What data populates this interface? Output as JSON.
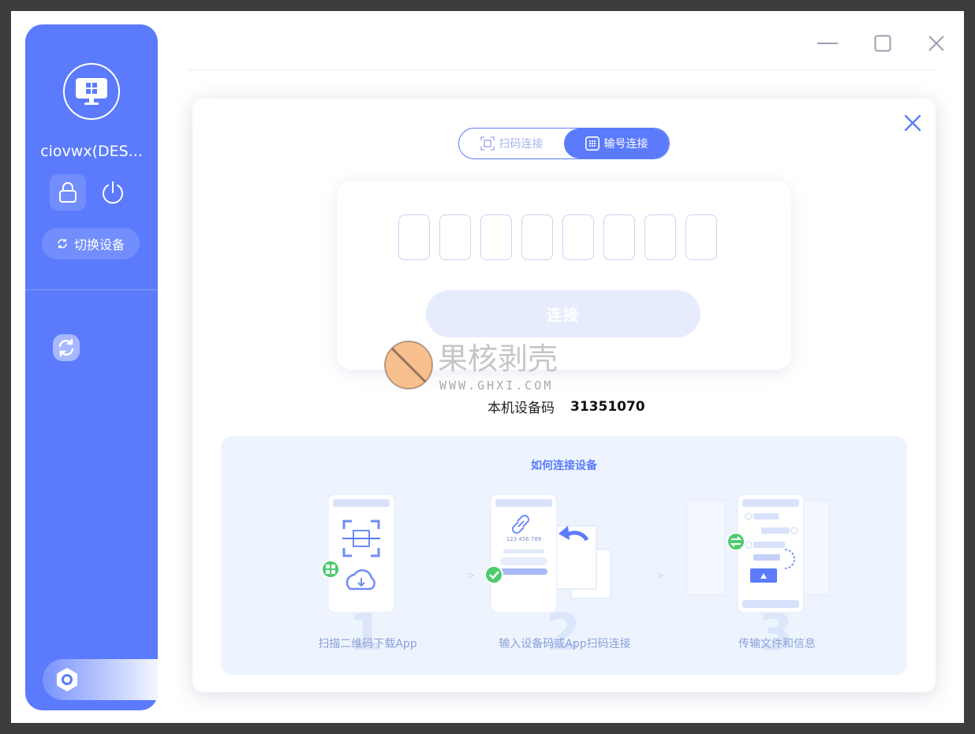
{
  "sidebar": {
    "device_name": "ciovwx(DES...",
    "switch_device_label": "切换设备"
  },
  "dialog": {
    "tabs": [
      {
        "label": "扫码连接",
        "active": false
      },
      {
        "label": "输号连接",
        "active": true
      }
    ],
    "connect_label": "连接",
    "local_code_label": "本机设备码",
    "local_code_value": "31351070",
    "howto": {
      "title": "如何连接设备",
      "steps": [
        {
          "number": "1",
          "label": "扫描二维码下载App"
        },
        {
          "number": "2",
          "label": "输入设备码或App扫码连接"
        },
        {
          "number": "3",
          "label": "传输文件和信息"
        }
      ],
      "sample_code": "123 456 789"
    }
  },
  "watermark": {
    "brand": "果核剥壳",
    "url": "WWW.GHXI.COM"
  },
  "colors": {
    "accent": "#5b7bfc",
    "disabled_button": "#e7ecfd",
    "panel_bg": "#eef4fe"
  }
}
